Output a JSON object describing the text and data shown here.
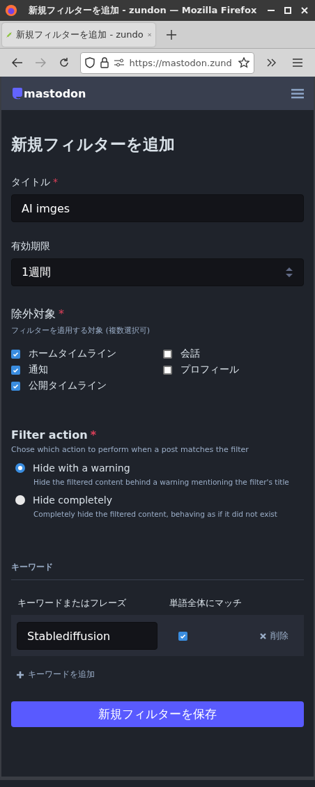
{
  "window": {
    "title": "新規フィルターを追加 - zundon — Mozilla Firefox"
  },
  "tab": {
    "title": "新規フィルターを追加 - zundo",
    "selected": true
  },
  "address_bar": {
    "url": "https://mastodon.zund"
  },
  "site_header": {
    "logo_text": "mastodon"
  },
  "heading": "新規フィルターを追加",
  "title_field": {
    "label": "タイトル",
    "required_mark": "*",
    "value": "AI imges"
  },
  "expiry_field": {
    "label": "有効期限",
    "value": "1週間"
  },
  "context": {
    "label": "除外対象",
    "required_mark": "*",
    "hint": "フィルターを適用する対象 (複数選択可)",
    "options": [
      {
        "label": "ホームタイムライン",
        "checked": true
      },
      {
        "label": "会話",
        "checked": false
      },
      {
        "label": "通知",
        "checked": true
      },
      {
        "label": "プロフィール",
        "checked": false
      },
      {
        "label": "公開タイムライン",
        "checked": true
      }
    ]
  },
  "filter_action": {
    "label": "Filter action",
    "required_mark": "*",
    "hint": "Chose which action to perform when a post matches the filter",
    "options": [
      {
        "label": "Hide with a warning",
        "description": "Hide the filtered content behind a warning mentioning the filter's title",
        "selected": true
      },
      {
        "label": "Hide completely",
        "description": "Completely hide the filtered content, behaving as if it did not exist",
        "selected": false
      }
    ]
  },
  "keywords": {
    "section_title": "キーワード",
    "columns": [
      "キーワードまたはフレーズ",
      "単語全体にマッチ"
    ],
    "rows": [
      {
        "keyword": "Stablediffusion",
        "whole_word": true,
        "remove_label": "削除"
      }
    ],
    "add_label": "キーワードを追加"
  },
  "save_button": "新規フィルターを保存"
}
